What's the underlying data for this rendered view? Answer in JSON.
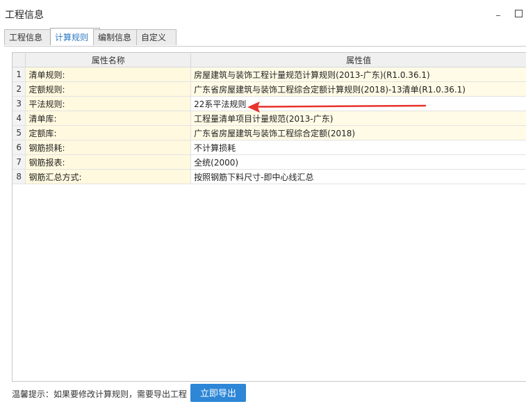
{
  "window": {
    "title": "工程信息"
  },
  "tabs": [
    {
      "label": "工程信息",
      "active": false
    },
    {
      "label": "计算规则",
      "active": true
    },
    {
      "label": "编制信息",
      "active": false
    },
    {
      "label": "自定义",
      "active": false
    }
  ],
  "table": {
    "columns": [
      "",
      "属性名称",
      "属性值"
    ],
    "rows": [
      {
        "index": "1",
        "name": "清单规则:",
        "value": "房屋建筑与装饰工程计量规范计算规则(2013-广东)(R1.0.36.1)"
      },
      {
        "index": "2",
        "name": "定额规则:",
        "value": "广东省房屋建筑与装饰工程综合定额计算规则(2018)-13清单(R1.0.36.1)"
      },
      {
        "index": "3",
        "name": "平法规则:",
        "value": "22系平法规则"
      },
      {
        "index": "4",
        "name": "清单库:",
        "value": "工程量清单项目计量规范(2013-广东)"
      },
      {
        "index": "5",
        "name": "定额库:",
        "value": "广东省房屋建筑与装饰工程综合定额(2018)"
      },
      {
        "index": "6",
        "name": "钢筋损耗:",
        "value": "不计算损耗"
      },
      {
        "index": "7",
        "name": "钢筋报表:",
        "value": "全统(2000)"
      },
      {
        "index": "8",
        "name": "钢筋汇总方式:",
        "value": "按照钢筋下料尺寸-即中心线汇总"
      }
    ]
  },
  "annotation": {
    "icon": "red-arrow-icon",
    "color": "#e8322b"
  },
  "footer": {
    "hint": "温馨提示：如果要修改计算规则，需要导出工程",
    "export_label": "立即导出"
  }
}
